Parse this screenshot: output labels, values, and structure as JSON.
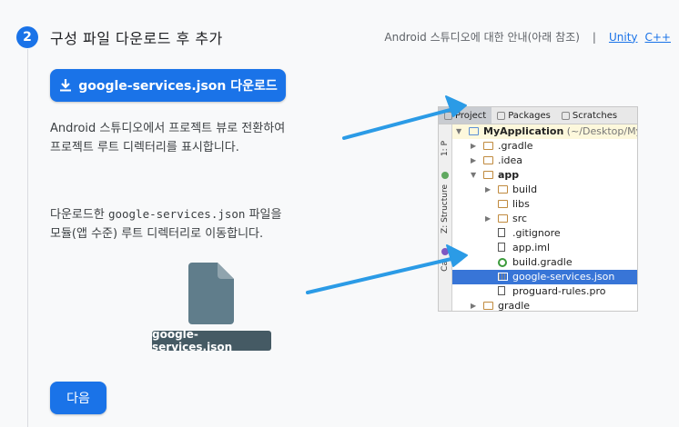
{
  "step": {
    "number": "2",
    "title": "구성 파일 다운로드 후 추가"
  },
  "help": {
    "text": "Android 스튜디오에 대한 안내(아래 참조)",
    "separator": "|",
    "links": [
      "Unity",
      "C++"
    ]
  },
  "download_button": {
    "icon": "download-icon",
    "label": "google-services.json 다운로드"
  },
  "instructions": {
    "p1_line1": "Android 스튜디오에서 프로젝트 뷰로 전환하여",
    "p1_line2": "프로젝트 루트 디렉터리를 표시합니다.",
    "p2_pre": "다운로드한 ",
    "p2_file": "google-services.json",
    "p2_post": " 파일을",
    "p2_line2": "모듈(앱 수준) 루트 디렉터리로 이동합니다."
  },
  "file_label": "google-services.json",
  "ide": {
    "tabs": [
      "Project",
      "Packages",
      "Scratches"
    ],
    "side_labels": [
      "1: P",
      "Z: Structure",
      "Ca"
    ],
    "tree": [
      {
        "label": "MyApplication",
        "suffix": " (~/Desktop/My",
        "indent": 0,
        "arrow": "▼",
        "icon": "blue"
      },
      {
        "label": ".gradle",
        "indent": 1,
        "arrow": "▶",
        "icon": "folder"
      },
      {
        "label": ".idea",
        "indent": 1,
        "arrow": "▶",
        "icon": "folder"
      },
      {
        "label": "app",
        "indent": 1,
        "arrow": "▼",
        "icon": "folder"
      },
      {
        "label": "build",
        "indent": 2,
        "arrow": "▶",
        "icon": "folder"
      },
      {
        "label": "libs",
        "indent": 2,
        "arrow": "",
        "icon": "folder"
      },
      {
        "label": "src",
        "indent": 2,
        "arrow": "▶",
        "icon": "folder"
      },
      {
        "label": ".gitignore",
        "indent": 2,
        "arrow": "",
        "icon": "file"
      },
      {
        "label": "app.iml",
        "indent": 2,
        "arrow": "",
        "icon": "file"
      },
      {
        "label": "build.gradle",
        "indent": 2,
        "arrow": "",
        "icon": "gradle"
      },
      {
        "label": "google-services.json",
        "indent": 2,
        "arrow": "",
        "icon": "json",
        "selected": true
      },
      {
        "label": "proguard-rules.pro",
        "indent": 2,
        "arrow": "",
        "icon": "file"
      },
      {
        "label": "gradle",
        "indent": 1,
        "arrow": "▶",
        "icon": "folder"
      }
    ]
  },
  "next_button": "다음",
  "colors": {
    "primary": "#1a73e8",
    "arrow": "#2b9be6",
    "selection": "#3875d7",
    "file_tag": "#455a64"
  }
}
